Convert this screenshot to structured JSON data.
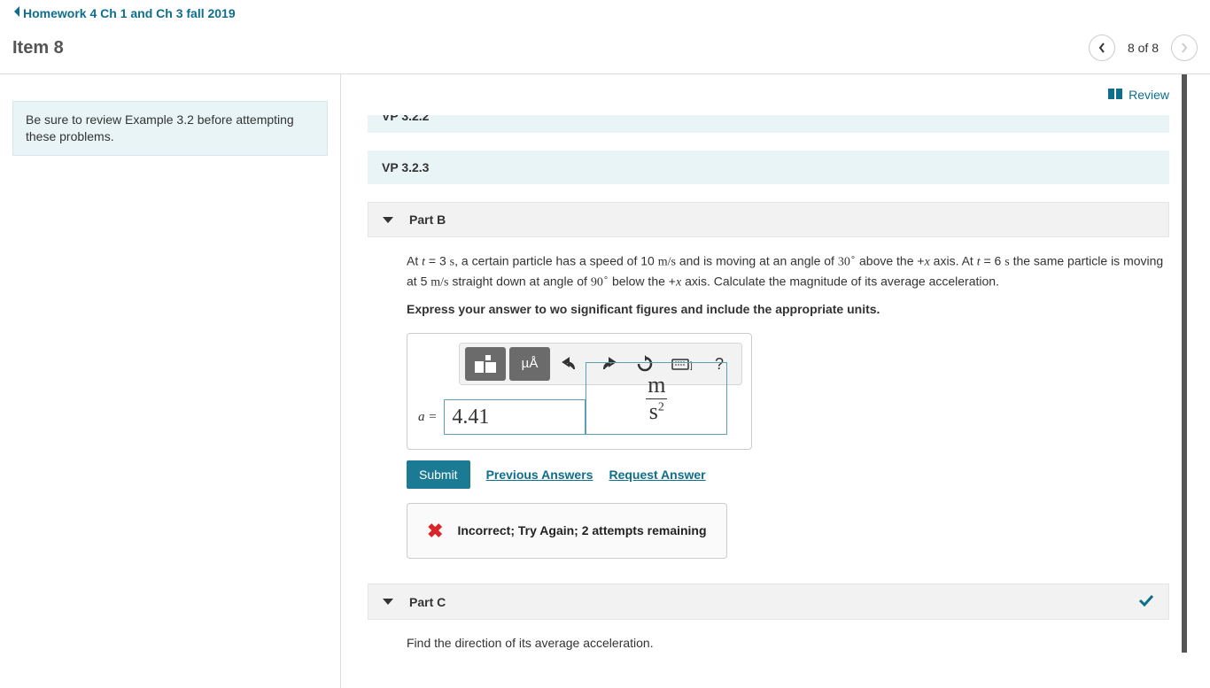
{
  "breadcrumb": {
    "label": "Homework 4 Ch 1 and Ch 3 fall 2019"
  },
  "header": {
    "item_title": "Item 8",
    "page_count": "8 of 8"
  },
  "sidebar": {
    "note": "Be sure to review Example 3.2 before attempting these problems."
  },
  "review": {
    "label": "Review"
  },
  "sections": {
    "s1": "VP 3.2.2",
    "s2": "VP 3.2.3"
  },
  "partB": {
    "title": "Part B",
    "prob_pre1": "At ",
    "t1var": "t",
    "t1eq": " = 3 ",
    "t1unit": "s",
    "prob_mid1": ", a certain particle has a speed of 10 ",
    "speed_unit": "m/s",
    "prob_mid2": " and is moving at an angle of ",
    "ang1": "30",
    "deg": "∘",
    "prob_mid3": " above the +",
    "xvar": "x",
    "prob_mid4": " axis. At ",
    "t2var": "t",
    "t2eq": " = 6 ",
    "t2unit": "s",
    "prob_mid5": " the same particle is moving at 5 ",
    "speed_unit2": "m/s",
    "prob_mid6": " straight down at angle of ",
    "ang2": "90",
    "prob_mid7": " below the +",
    "prob_end": " axis. Calculate the magnitude of its average acceleration.",
    "instruction": "Express your answer to wo significant figures and include the appropriate units.",
    "a_label": "a =",
    "value": "4.41",
    "unit_num": "m",
    "unit_den": "s",
    "unit_exp": "2",
    "submit": "Submit",
    "prev_answers": "Previous Answers",
    "request_answer": "Request Answer",
    "feedback": "Incorrect; Try Again; 2 attempts remaining",
    "toolbar": {
      "mu": "µÅ",
      "help": "?"
    }
  },
  "partC": {
    "title": "Part C",
    "text": "Find the direction of its average acceleration."
  }
}
